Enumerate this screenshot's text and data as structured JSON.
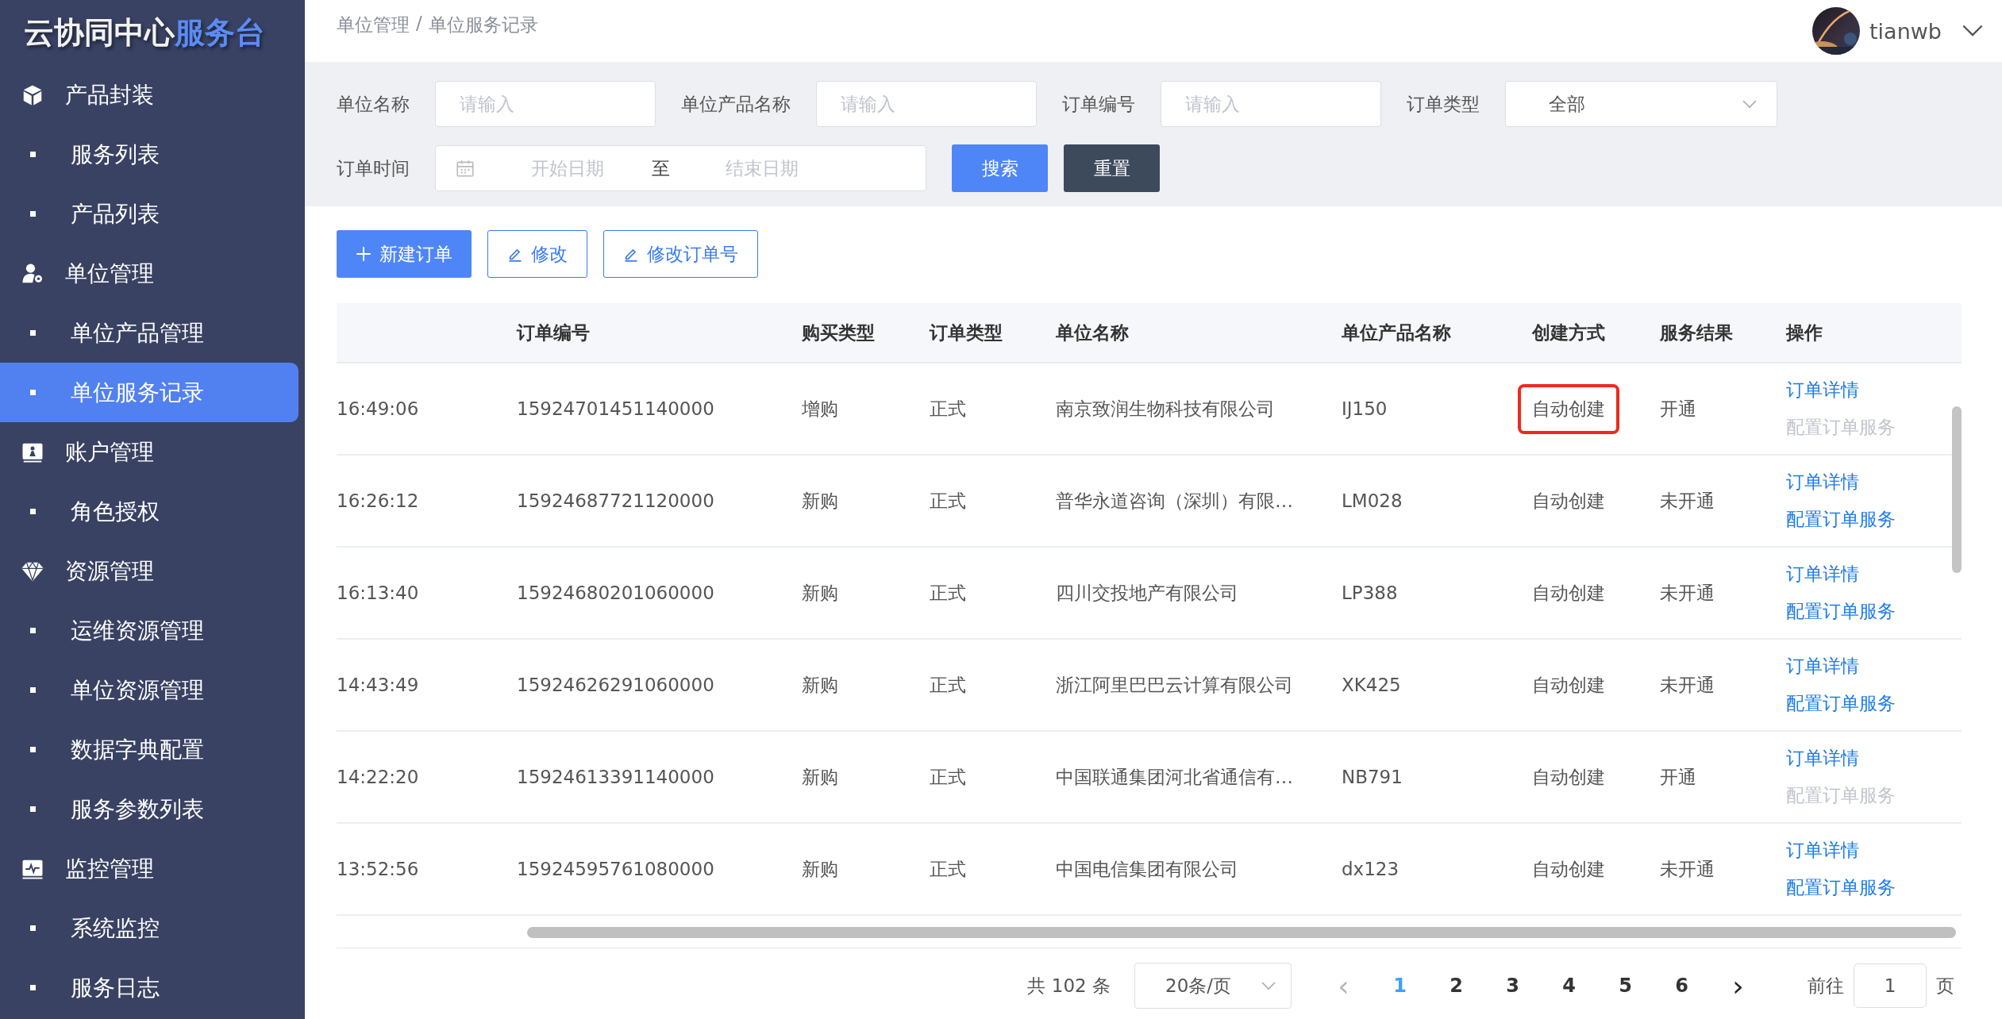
{
  "logo": {
    "main": "云协同中心",
    "accent": "服务台"
  },
  "sidebar": {
    "items": [
      {
        "kind": "group",
        "label": "产品封装",
        "selected": false
      },
      {
        "kind": "item",
        "label": "服务列表",
        "selected": false
      },
      {
        "kind": "item",
        "label": "产品列表",
        "selected": false
      },
      {
        "kind": "group",
        "label": "单位管理",
        "selected": false
      },
      {
        "kind": "item",
        "label": "单位产品管理",
        "selected": false
      },
      {
        "kind": "item",
        "label": "单位服务记录",
        "selected": true
      },
      {
        "kind": "group",
        "label": "账户管理",
        "selected": false
      },
      {
        "kind": "item",
        "label": "角色授权",
        "selected": false
      },
      {
        "kind": "group",
        "label": "资源管理",
        "selected": false
      },
      {
        "kind": "item",
        "label": "运维资源管理",
        "selected": false
      },
      {
        "kind": "item",
        "label": "单位资源管理",
        "selected": false
      },
      {
        "kind": "item",
        "label": "数据字典配置",
        "selected": false
      },
      {
        "kind": "item",
        "label": "服务参数列表",
        "selected": false
      },
      {
        "kind": "group",
        "label": "监控管理",
        "selected": false
      },
      {
        "kind": "item",
        "label": "系统监控",
        "selected": false
      },
      {
        "kind": "item",
        "label": "服务日志",
        "selected": false
      }
    ]
  },
  "header": {
    "breadcrumb": [
      "单位管理",
      "/",
      "单位服务记录"
    ],
    "user": "tianwb"
  },
  "filters": {
    "unit_name": {
      "label": "单位名称",
      "placeholder": "请输入"
    },
    "unit_product_name": {
      "label": "单位产品名称",
      "placeholder": "请输入"
    },
    "order_no": {
      "label": "订单编号",
      "placeholder": "请输入"
    },
    "order_type": {
      "label": "订单类型",
      "value": "全部"
    },
    "order_time": {
      "label": "订单时间",
      "start_placeholder": "开始日期",
      "separator": "至",
      "end_placeholder": "结束日期"
    },
    "buttons": [
      {
        "kind": "primary",
        "label": "搜索"
      },
      {
        "kind": "dark",
        "label": "重置"
      }
    ]
  },
  "toolbar": [
    {
      "kind": "primary",
      "label": "新建订单"
    },
    {
      "kind": "outline",
      "label": "修改"
    },
    {
      "kind": "outline",
      "label": "修改订单号"
    }
  ],
  "table": {
    "columns": [
      "",
      "订单编号",
      "购买类型",
      "订单类型",
      "单位名称",
      "单位产品名称",
      "创建方式",
      "服务结果",
      "操作"
    ],
    "rows": [
      {
        "time": "16:49:06",
        "order_no": "15924701451140000",
        "purchase_type": "增购",
        "order_type": "正式",
        "unit_name": "南京致润生物科技有限公司",
        "product": "IJ150",
        "creation": "自动创建",
        "highlighted": true,
        "result": "开通",
        "actions": [
          {
            "label": "订单详情",
            "disabled": false
          },
          {
            "label": "配置订单服务",
            "disabled": true
          }
        ]
      },
      {
        "time": "16:26:12",
        "order_no": "15924687721120000",
        "purchase_type": "新购",
        "order_type": "正式",
        "unit_name": "普华永道咨询（深圳）有限…",
        "product": "LM028",
        "creation": "自动创建",
        "highlighted": false,
        "result": "未开通",
        "actions": [
          {
            "label": "订单详情",
            "disabled": false
          },
          {
            "label": "配置订单服务",
            "disabled": false
          }
        ]
      },
      {
        "time": "16:13:40",
        "order_no": "15924680201060000",
        "purchase_type": "新购",
        "order_type": "正式",
        "unit_name": "四川交投地产有限公司",
        "product": "LP388",
        "creation": "自动创建",
        "highlighted": false,
        "result": "未开通",
        "actions": [
          {
            "label": "订单详情",
            "disabled": false
          },
          {
            "label": "配置订单服务",
            "disabled": false
          }
        ]
      },
      {
        "time": "14:43:49",
        "order_no": "15924626291060000",
        "purchase_type": "新购",
        "order_type": "正式",
        "unit_name": "浙江阿里巴巴云计算有限公司",
        "product": "XK425",
        "creation": "自动创建",
        "highlighted": false,
        "result": "未开通",
        "actions": [
          {
            "label": "订单详情",
            "disabled": false
          },
          {
            "label": "配置订单服务",
            "disabled": false
          }
        ]
      },
      {
        "time": "14:22:20",
        "order_no": "15924613391140000",
        "purchase_type": "新购",
        "order_type": "正式",
        "unit_name": "中国联通集团河北省通信有…",
        "product": "NB791",
        "creation": "自动创建",
        "highlighted": false,
        "result": "开通",
        "actions": [
          {
            "label": "订单详情",
            "disabled": false
          },
          {
            "label": "配置订单服务",
            "disabled": true
          }
        ]
      },
      {
        "time": "13:52:56",
        "order_no": "15924595761080000",
        "purchase_type": "新购",
        "order_type": "正式",
        "unit_name": "中国电信集团有限公司",
        "product": "dx123",
        "creation": "自动创建",
        "highlighted": false,
        "result": "未开通",
        "actions": [
          {
            "label": "订单详情",
            "disabled": false
          },
          {
            "label": "配置订单服务",
            "disabled": false
          }
        ]
      }
    ]
  },
  "pagination": {
    "total": "共 102 条",
    "page_size": "20条/页",
    "prev": "‹",
    "pages": [
      {
        "label": "1",
        "selected": true
      },
      {
        "label": "2",
        "selected": false
      },
      {
        "label": "3",
        "selected": false
      },
      {
        "label": "4",
        "selected": false
      },
      {
        "label": "5",
        "selected": false
      },
      {
        "label": "6",
        "selected": false
      }
    ],
    "next": "›",
    "goto_label": "前往",
    "goto_value": "1",
    "goto_suffix": "页"
  }
}
